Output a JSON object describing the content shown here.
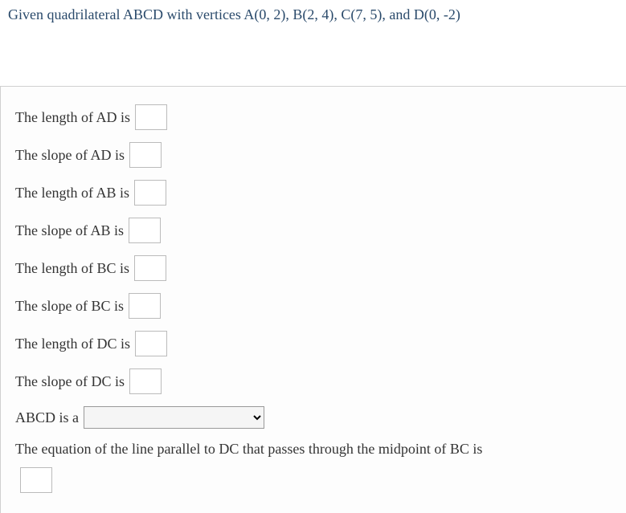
{
  "prompt": "Given quadrilateral ABCD with vertices A(0, 2), B(2, 4), C(7, 5), and D(0, -2)",
  "lines": {
    "length_ad": "The length of AD is",
    "slope_ad": "The slope of AD is",
    "length_ab": "The length of AB is",
    "slope_ab": "The slope of AB is",
    "length_bc": "The length of BC is",
    "slope_bc": "The slope of BC is",
    "length_dc": "The length of DC is",
    "slope_dc": "The slope of DC is",
    "abcd_is": "ABCD is a",
    "equation": "The equation of the line parallel to DC that passes through the midpoint of BC is"
  },
  "inputs": {
    "length_ad": "",
    "slope_ad": "",
    "length_ab": "",
    "slope_ab": "",
    "length_bc": "",
    "slope_bc": "",
    "length_dc": "",
    "slope_dc": "",
    "abcd_type": "",
    "equation_answer": ""
  }
}
